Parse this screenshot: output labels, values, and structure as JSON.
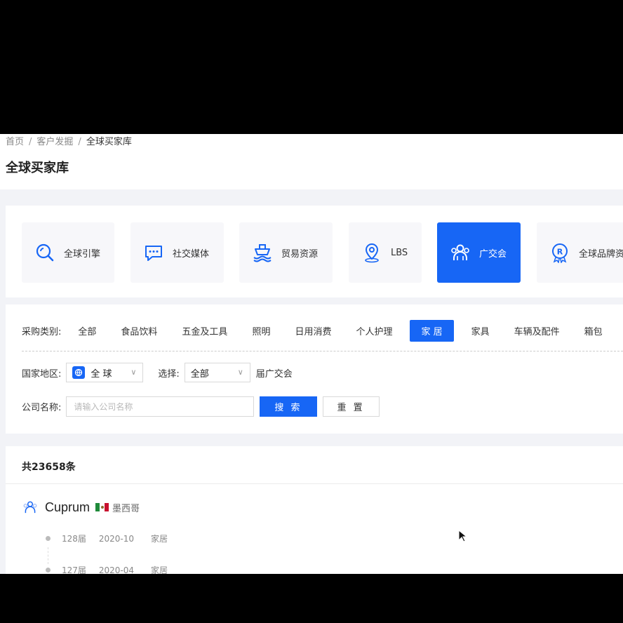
{
  "breadcrumb": [
    "首页",
    "客户发掘",
    "全球买家库"
  ],
  "page_title": "全球买家库",
  "categories": [
    {
      "label": "全球引擎",
      "icon": "search-icon"
    },
    {
      "label": "社交媒体",
      "icon": "chat-icon"
    },
    {
      "label": "贸易资源",
      "icon": "ship-icon"
    },
    {
      "label": "LBS",
      "icon": "location-pin-icon"
    },
    {
      "label": "广交会",
      "icon": "people-icon",
      "active": true
    },
    {
      "label": "全球品牌资",
      "icon": "brand-badge-icon"
    }
  ],
  "filters": {
    "category_label": "采购类别:",
    "category_options": [
      "全部",
      "食品饮料",
      "五金及工具",
      "照明",
      "日用消费",
      "个人护理",
      "家 居",
      "家具",
      "车辆及配件",
      "箱包"
    ],
    "active_category": "家 居",
    "region_label": "国家地区:",
    "region_value": "全 球",
    "select_label": "选择:",
    "select_value": "全部",
    "session_suffix": "届广交会",
    "company_label": "公司名称:",
    "company_placeholder": "请输入公司名称",
    "search_button": "搜 索",
    "reset_button": "重 置"
  },
  "results": {
    "total": "共23658条",
    "items": [
      {
        "company": "Cuprum",
        "country": "墨西哥",
        "records": [
          {
            "session": "128届",
            "date": "2020-10",
            "category": "家居"
          },
          {
            "session": "127届",
            "date": "2020-04",
            "category": "家居"
          }
        ]
      }
    ]
  },
  "colors": {
    "accent": "#1766f5",
    "page_bg": "#f2f3f7",
    "card_bg": "#f7f7fa"
  }
}
